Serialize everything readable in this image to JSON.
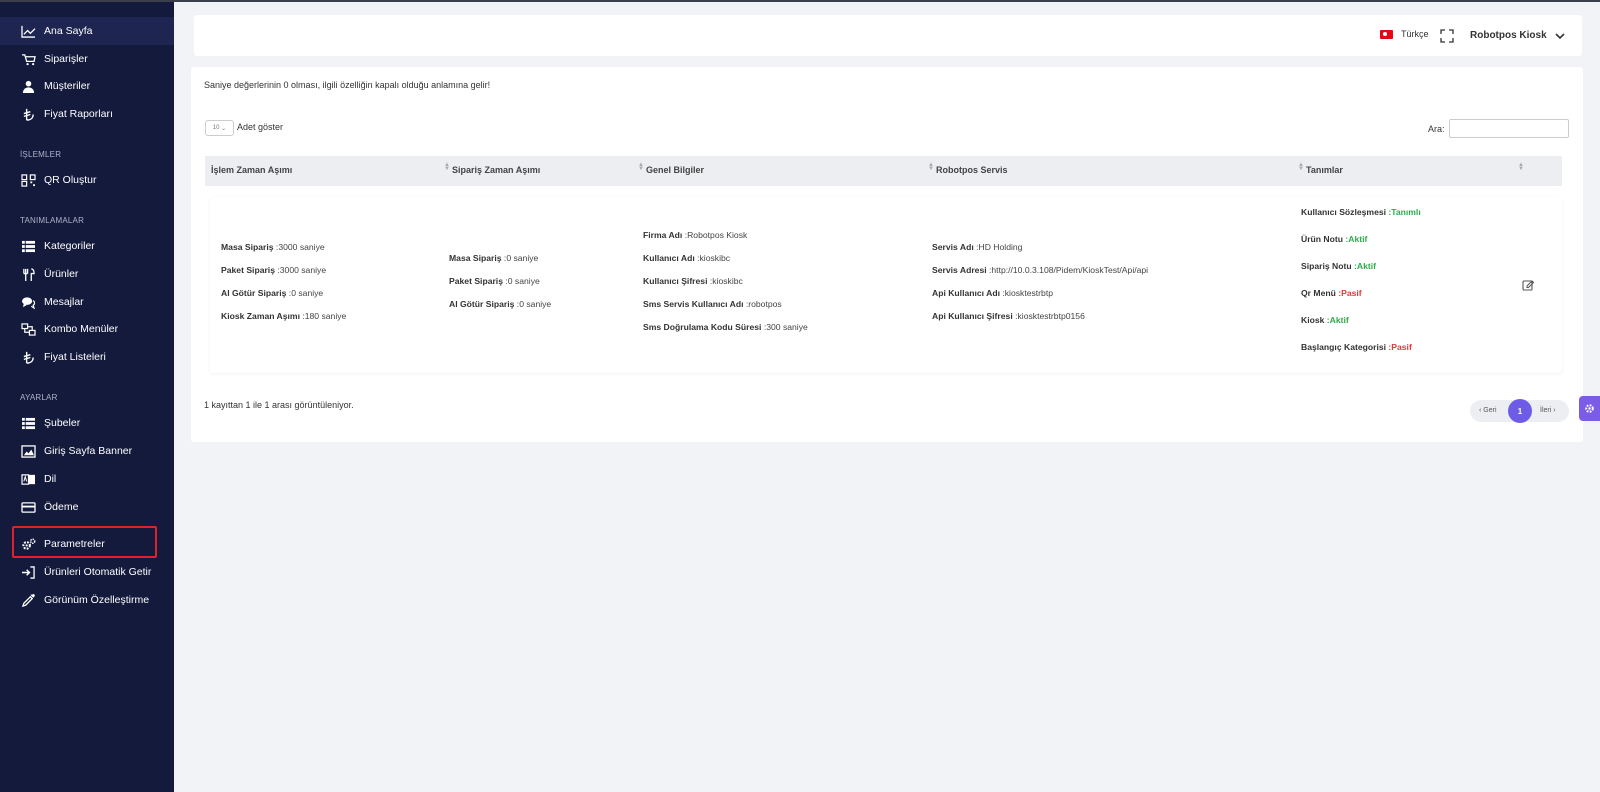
{
  "sidebar": {
    "menu": [
      {
        "label": "Ana Sayfa",
        "icon": "chart-line-icon"
      },
      {
        "label": "Siparişler",
        "icon": "cart-icon"
      },
      {
        "label": "Müşteriler",
        "icon": "user-icon"
      },
      {
        "label": "Fiyat Raporları",
        "icon": "lira-icon"
      }
    ],
    "section_islemler": "İŞLEMLER",
    "islemler": [
      {
        "label": "QR Oluştur",
        "icon": "qrcode-icon"
      }
    ],
    "section_tanimlamalar": "TANIMLAMALAR",
    "tanimlamalar": [
      {
        "label": "Kategoriler",
        "icon": "list-icon"
      },
      {
        "label": "Ürünler",
        "icon": "utensils-icon"
      },
      {
        "label": "Mesajlar",
        "icon": "comments-icon"
      },
      {
        "label": "Kombo Menüler",
        "icon": "combo-icon"
      },
      {
        "label": "Fiyat Listeleri",
        "icon": "lira-icon"
      }
    ],
    "section_ayarlar": "AYARLAR",
    "ayarlar": [
      {
        "label": "Şubeler",
        "icon": "list-icon"
      },
      {
        "label": "Giriş Sayfa Banner",
        "icon": "image-icon"
      },
      {
        "label": "Dil",
        "icon": "language-icon"
      },
      {
        "label": "Ödeme",
        "icon": "credit-card-icon"
      },
      {
        "label": "Parametreler",
        "icon": "cogs-icon"
      },
      {
        "label": "Ürünleri Otomatik Getir",
        "icon": "sign-in-icon"
      },
      {
        "label": "Görünüm Özelleştirme",
        "icon": "eyedropper-icon"
      }
    ]
  },
  "header": {
    "language": "Türkçe",
    "user_name": "Robotpos Kiosk"
  },
  "main": {
    "note": "Saniye değerlerinin 0 olması, ilgili özelliğin kapalı olduğu anlamına gelir!",
    "page_length_value": "10",
    "page_length_label": "Adet göster",
    "search_label": "Ara:",
    "search_value": "",
    "columns": [
      "İşlem Zaman Aşımı",
      "Sipariş Zaman Aşımı",
      "Genel Bilgiler",
      "Robotpos Servis",
      "Tanımlar"
    ],
    "row": {
      "islem": [
        {
          "k": "Masa Sipariş",
          "v": " :3000 saniye"
        },
        {
          "k": "Paket Sipariş",
          "v": " :3000 saniye"
        },
        {
          "k": "Al Götür Sipariş",
          "v": " :0 saniye"
        },
        {
          "k": "Kiosk Zaman Aşımı",
          "v": " :180 saniye"
        }
      ],
      "siparis": [
        {
          "k": "Masa Sipariş",
          "v": " :0 saniye"
        },
        {
          "k": "Paket Sipariş",
          "v": " :0 saniye"
        },
        {
          "k": "Al Götür Sipariş",
          "v": " :0 saniye"
        }
      ],
      "genel": [
        {
          "k": "Firma Adı",
          "v": " :Robotpos Kiosk"
        },
        {
          "k": "Kullanıcı Adı",
          "v": " :kioskibc"
        },
        {
          "k": "Kullanıcı Şifresi",
          "v": " :kioskibc"
        },
        {
          "k": "Sms Servis Kullanıcı Adı",
          "v": " :robotpos"
        },
        {
          "k": "Sms Doğrulama Kodu Süresi",
          "v": " :300 saniye"
        }
      ],
      "servis": [
        {
          "k": "Servis Adı",
          "v": " :HD Holding"
        },
        {
          "k": "Servis Adresi",
          "v": " :http://10.0.3.108/Pidem/KioskTest/Api/api"
        },
        {
          "k": "Api Kullanıcı Adı",
          "v": " :kiosktestrbtp"
        },
        {
          "k": "Api Kullanıcı Şifresi",
          "v": " :kiosktestrbtp0156"
        }
      ],
      "tanimlar": [
        {
          "k": "Kullanıcı Sözleşmesi",
          "v": " :Tanımlı",
          "status": "ok"
        },
        {
          "k": "Ürün Notu",
          "v": " :Aktif",
          "status": "ok"
        },
        {
          "k": "Sipariş Notu",
          "v": " :Aktif",
          "status": "ok"
        },
        {
          "k": "Qr Menü",
          "v": " :Pasif",
          "status": "bad"
        },
        {
          "k": "Kiosk",
          "v": " :Aktif",
          "status": "ok"
        },
        {
          "k": "Başlangıç Kategorisi",
          "v": " :Pasif",
          "status": "bad"
        }
      ]
    },
    "info": "1 kayıttan 1 ile 1 arası görüntüleniyor.",
    "pager": {
      "prev": "‹ Geri",
      "current": "1",
      "next": "İleri ›"
    }
  },
  "colors": {
    "sidebar": "#131a3c",
    "accent": "#6e5ce6",
    "active": "#2eaa4a",
    "passive": "#e03a3a",
    "highlight_box": "#e0202c"
  }
}
